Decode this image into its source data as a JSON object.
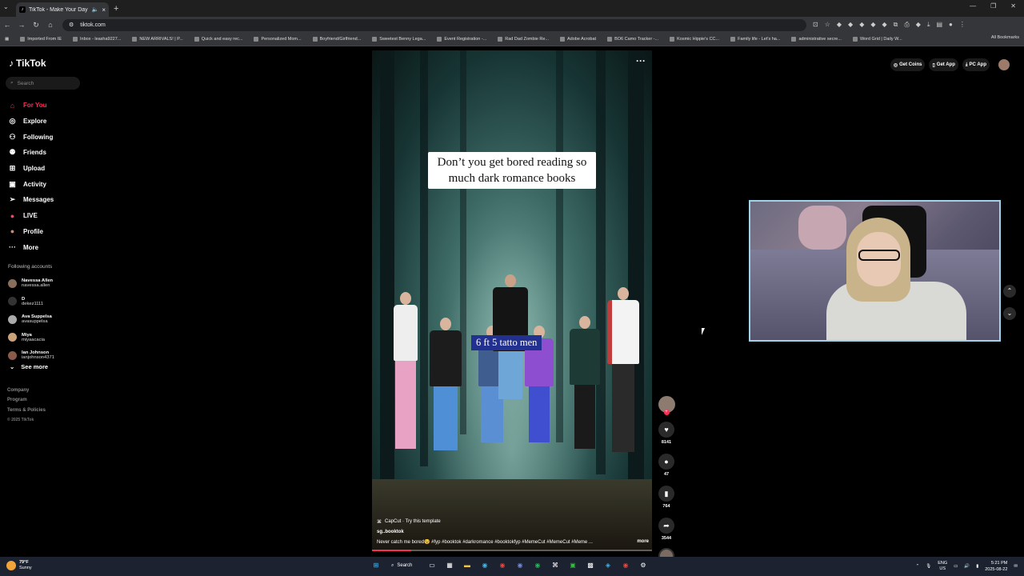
{
  "browser": {
    "tab_title": "TikTok - Make Your Day",
    "url": "tiktok.com",
    "bookmarks": [
      "Imported From IE",
      "Inbox - leasha9227...",
      "NEW ARRIVALS! | P...",
      "Quick and easy rec...",
      "Personalized Mom...",
      "Boyfriend/Girlfriend...",
      "Sweetest Benny Lega...",
      "Event Registration -...",
      "Rad Dad Zombie Re...",
      "Adobe Acrobat",
      "BO6 Camo Tracker -...",
      "Kosmic Hippie's CC...",
      "Family life - Let's ha...",
      "administrative secre...",
      "Word Grid | Daily W..."
    ],
    "all_bookmarks": "All Bookmarks"
  },
  "sidebar": {
    "logo": "TikTok",
    "search_placeholder": "Search",
    "nav": [
      {
        "label": "For You",
        "icon": "home-icon"
      },
      {
        "label": "Explore",
        "icon": "compass-icon"
      },
      {
        "label": "Following",
        "icon": "following-icon"
      },
      {
        "label": "Friends",
        "icon": "friends-icon"
      },
      {
        "label": "Upload",
        "icon": "upload-icon"
      },
      {
        "label": "Activity",
        "icon": "activity-icon"
      },
      {
        "label": "Messages",
        "icon": "messages-icon"
      },
      {
        "label": "LIVE",
        "icon": "live-icon"
      },
      {
        "label": "Profile",
        "icon": "profile-icon"
      },
      {
        "label": "More",
        "icon": "more-icon"
      }
    ],
    "following_title": "Following accounts",
    "accounts": [
      {
        "name": "Navessa Allen",
        "handle": "navessa.allen"
      },
      {
        "name": "D",
        "handle": "dekez1111"
      },
      {
        "name": "Ava Suppelsa",
        "handle": "avasuppelsa"
      },
      {
        "name": "Miya",
        "handle": "miyaacacia"
      },
      {
        "name": "Ian Johnson",
        "handle": "ianjohnson4371"
      }
    ],
    "see_more": "See more",
    "footer": [
      "Company",
      "Program",
      "Terms & Policies"
    ],
    "copyright": "© 2025 TikTok"
  },
  "topbar": {
    "get_coins": "Get Coins",
    "get_app": "Get App",
    "pc_app": "PC App"
  },
  "video": {
    "caption_top": "Don’t you get bored reading so much dark romance books",
    "caption_mid": "6 ft 5 tatto men",
    "capcut": "CapCut · Try this template",
    "username": "sg..booktok",
    "description": "Never catch me bored😉 #fyp #booktok #darkromance #booktokfyp #MemeCut #MemeCut #Meme ...",
    "more": "more",
    "progress": 0.14
  },
  "actions": {
    "likes": "8141",
    "comments": "47",
    "saves": "764",
    "shares": "3544"
  },
  "taskbar": {
    "temp": "79°F",
    "weather": "Sunny",
    "search": "Search",
    "lang1": "ENG",
    "lang2": "US",
    "time": "5:21 PM",
    "date": "2025-08-22"
  }
}
